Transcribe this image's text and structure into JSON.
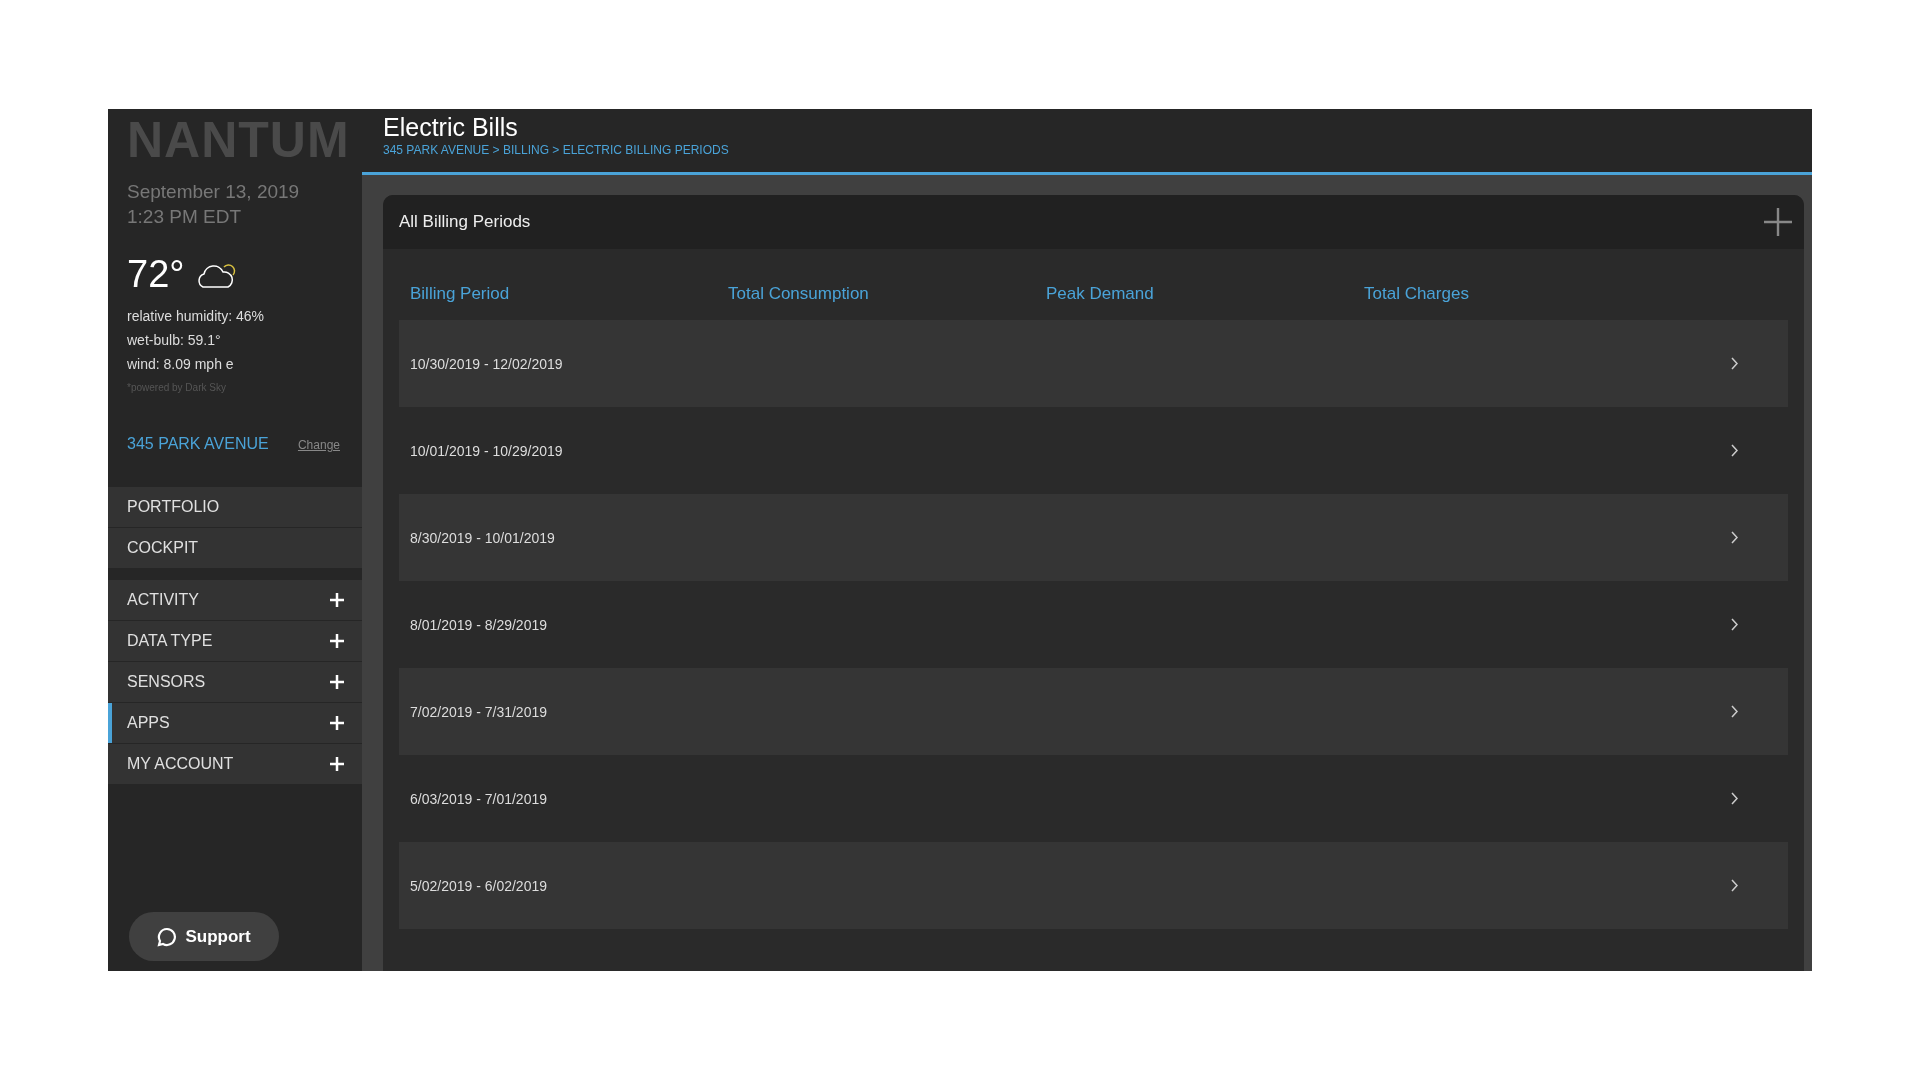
{
  "sidebar": {
    "logo": "NANTUM",
    "date": "September 13, 2019",
    "time": "1:23 PM EDT",
    "weather": {
      "temperature": "72°",
      "details": [
        "relative humidity: 46%",
        "wet-bulb: 59.1°",
        "wind: 8.09 mph e"
      ],
      "credit": "*powered by Dark Sky"
    },
    "building": {
      "name": "345 PARK AVENUE",
      "change_link": "Change"
    },
    "primary_nav": [
      {
        "label": "PORTFOLIO",
        "selected": false
      },
      {
        "label": "COCKPIT",
        "selected": false
      }
    ],
    "sections": [
      {
        "label": "ACTIVITY",
        "selected": false
      },
      {
        "label": "DATA TYPE",
        "selected": false
      },
      {
        "label": "SENSORS",
        "selected": false
      },
      {
        "label": "APPS",
        "selected": true
      },
      {
        "label": "MY ACCOUNT",
        "selected": false
      }
    ],
    "support_button": "Support"
  },
  "header": {
    "title": "Electric Bills",
    "breadcrumb": "345 PARK AVENUE > BILLING > ELECTRIC BILLING PERIODS"
  },
  "card": {
    "title": "All Billing Periods",
    "table": {
      "columns": [
        "Billing Period",
        "Total Consumption",
        "Peak Demand",
        "Total Charges"
      ],
      "rows": [
        {
          "period": "10/30/2019 - 12/02/2019"
        },
        {
          "period": "10/01/2019 - 10/29/2019"
        },
        {
          "period": "8/30/2019 - 10/01/2019"
        },
        {
          "period": "8/01/2019 - 8/29/2019"
        },
        {
          "period": "7/02/2019 - 7/31/2019"
        },
        {
          "period": "6/03/2019 - 7/01/2019"
        },
        {
          "period": "5/02/2019 - 6/02/2019"
        }
      ]
    }
  }
}
